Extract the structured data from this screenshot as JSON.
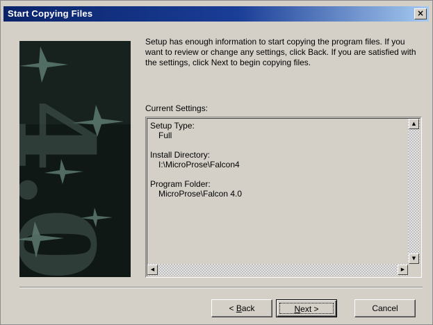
{
  "window": {
    "title": "Start Copying Files",
    "close_glyph": "×"
  },
  "banner": {
    "image_text": "4.0",
    "icon": "falcon-jets-banner"
  },
  "intro": {
    "text": "Setup has enough information to start copying the program files. If you want to review or change any settings, click Back. If you are satisfied with the settings, click Next to begin copying files."
  },
  "settings": {
    "label": "Current Settings:",
    "groups": [
      {
        "heading": "Setup Type:",
        "value": "Full"
      },
      {
        "heading": "Install Directory:",
        "value": "I:\\MicroProse\\Falcon4"
      },
      {
        "heading": "Program Folder:",
        "value": "MicroProse\\Falcon 4.0"
      }
    ]
  },
  "scrollbar": {
    "up_glyph": "▲",
    "down_glyph": "▼",
    "left_glyph": "◀",
    "right_glyph": "▶"
  },
  "buttons": {
    "back_prefix": "< ",
    "back_key": "B",
    "back_rest": "ack",
    "next_key": "N",
    "next_rest": "ext >",
    "cancel": "Cancel"
  },
  "colors": {
    "titlebar_start": "#0a246a",
    "titlebar_end": "#a6caf0",
    "dialog_face": "#d4d0c8"
  }
}
